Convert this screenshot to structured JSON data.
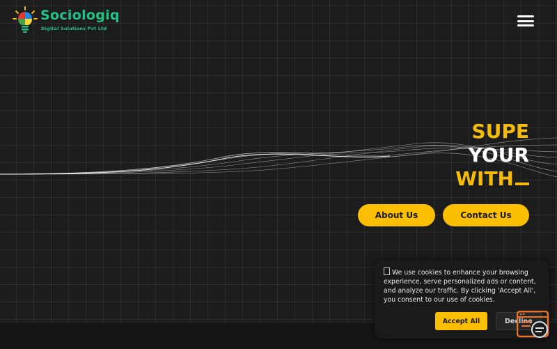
{
  "header": {
    "logo": {
      "name": "Sociologiq",
      "tagline": "Digital Solutions Pvt Ltd"
    },
    "menu_icon": "hamburger-menu-icon"
  },
  "hero": {
    "lines": [
      "SUPE",
      "YOUR",
      "WITH"
    ],
    "buttons": {
      "about": "About Us",
      "contact": "Contact Us"
    }
  },
  "cookie_banner": {
    "message": "We use cookies to enhance your browsing experience, serve personalized ads or content, and analyze our traffic. By clicking 'Accept All', you consent to our use of cookies.",
    "accept_label": "Accept All",
    "decline_label": "Decline"
  },
  "colors": {
    "accent": "#fcbf00",
    "headline_yellow": "#f5bb0b",
    "background": "#1c1c1c",
    "logo_green": "#21c28a"
  }
}
